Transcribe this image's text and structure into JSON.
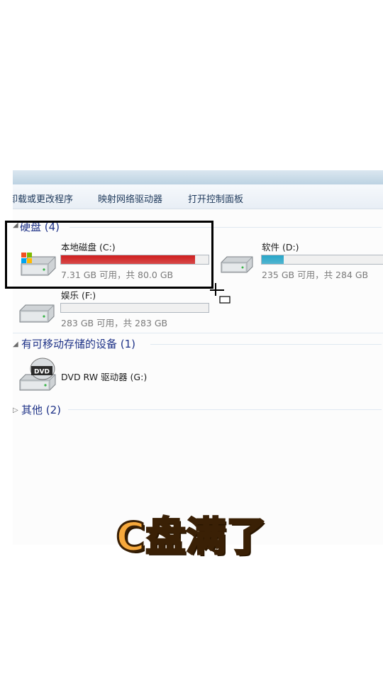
{
  "toolbar": {
    "items": [
      "卸载或更改程序",
      "映射网络驱动器",
      "打开控制面板"
    ]
  },
  "groups": {
    "hard_disks": "硬盘 (4)",
    "removable": "有可移动存储的设备 (1)",
    "other": "其他 (2)"
  },
  "drives": [
    {
      "name": "本地磁盘 (C:)",
      "space": "7.31 GB 可用，共 80.0 GB",
      "used_fraction": 0.91,
      "bar_color": "#d01f1f"
    },
    {
      "name": "软件 (D:)",
      "space": "235 GB 可用，共 284 GB",
      "used_fraction": 0.17,
      "bar_color": "#28a6c8"
    },
    {
      "name": "娱乐 (F:)",
      "space": "283 GB 可用，共 283 GB",
      "used_fraction": 0.0,
      "bar_color": "#28a6c8"
    }
  ],
  "dvd": {
    "name": "DVD RW 驱动器 (G:)",
    "badge": "DVD"
  },
  "caption": "C盘满了"
}
